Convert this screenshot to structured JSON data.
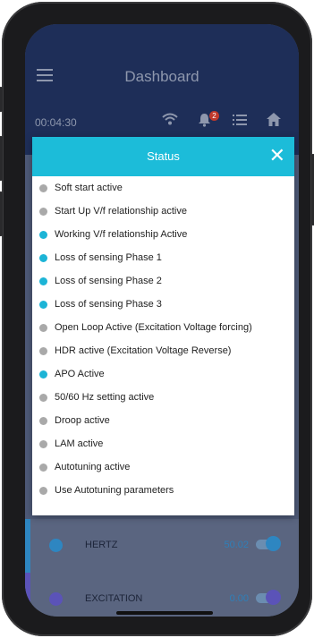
{
  "header": {
    "title": "Dashboard",
    "timer": "00:04:30",
    "notification_count": "2"
  },
  "icons": {
    "menu": "hamburger-icon",
    "wifi": "wifi-icon",
    "bell": "bell-icon",
    "list": "list-icon",
    "home": "home-icon"
  },
  "modal": {
    "title": "Status",
    "close_label": "✕",
    "items": [
      {
        "label": "Soft start active",
        "active": false
      },
      {
        "label": "Start Up V/f relationship active",
        "active": false
      },
      {
        "label": "Working V/f relationship Active",
        "active": true
      },
      {
        "label": "Loss of sensing Phase 1",
        "active": true
      },
      {
        "label": "Loss of sensing Phase 2",
        "active": true
      },
      {
        "label": "Loss of sensing Phase 3",
        "active": true
      },
      {
        "label": "Open Loop Active (Excitation Voltage forcing)",
        "active": false
      },
      {
        "label": "HDR active (Excitation Voltage Reverse)",
        "active": false
      },
      {
        "label": "APO Active",
        "active": true
      },
      {
        "label": "50/60 Hz setting active",
        "active": false
      },
      {
        "label": "Droop active",
        "active": false
      },
      {
        "label": "LAM active",
        "active": false
      },
      {
        "label": "Autotuning active",
        "active": false
      },
      {
        "label": "Use Autotuning parameters",
        "active": false
      }
    ]
  },
  "background_rows": [
    {
      "label": "HERTZ",
      "value": "50.02",
      "color": "#2e86c1"
    },
    {
      "label": "EXCITATION",
      "value": "0.00",
      "color": "#5b53b8"
    }
  ],
  "colors": {
    "active_dot": "#1cb4d6",
    "inactive_dot": "#a9a9a9",
    "modal_header": "#1cbcd9",
    "app_bar": "#1e2e58"
  }
}
